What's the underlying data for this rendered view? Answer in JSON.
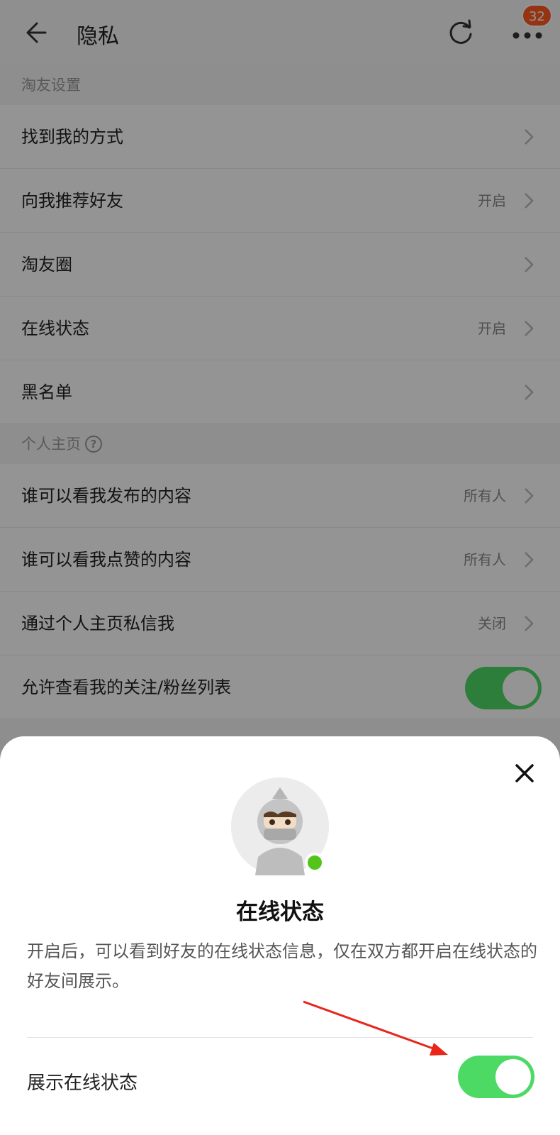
{
  "header": {
    "title": "隐私",
    "badge_count": "32",
    "icons": [
      "arrow-left-icon",
      "refresh-icon",
      "more-icon"
    ]
  },
  "sections": [
    {
      "title": "淘友设置",
      "rows": [
        {
          "label": "找到我的方式",
          "value": ""
        },
        {
          "label": "向我推荐好友",
          "value": "开启"
        },
        {
          "label": "淘友圈",
          "value": ""
        },
        {
          "label": "在线状态",
          "value": "开启"
        },
        {
          "label": "黑名单",
          "value": ""
        }
      ]
    },
    {
      "title": "个人主页",
      "rows": [
        {
          "label": "谁可以看我发布的内容",
          "value": "所有人"
        },
        {
          "label": "谁可以看我点赞的内容",
          "value": "所有人"
        },
        {
          "label": "通过个人主页私信我",
          "value": "关闭"
        },
        {
          "label": "允许查看我的关注/粉丝列表",
          "value": "",
          "toggle": true
        }
      ]
    }
  ],
  "sheet": {
    "title": "在线状态",
    "description": "开启后，可以看到好友的在线状态信息，仅在双方都开启在线状态的好友间展示。",
    "toggle_label": "展示在线状态",
    "toggle_on": true
  },
  "colors": {
    "accent": "#ff5a1f",
    "switch_on": "#4cd964",
    "online_dot": "#52c41a",
    "annotation_arrow": "#e8261a"
  }
}
